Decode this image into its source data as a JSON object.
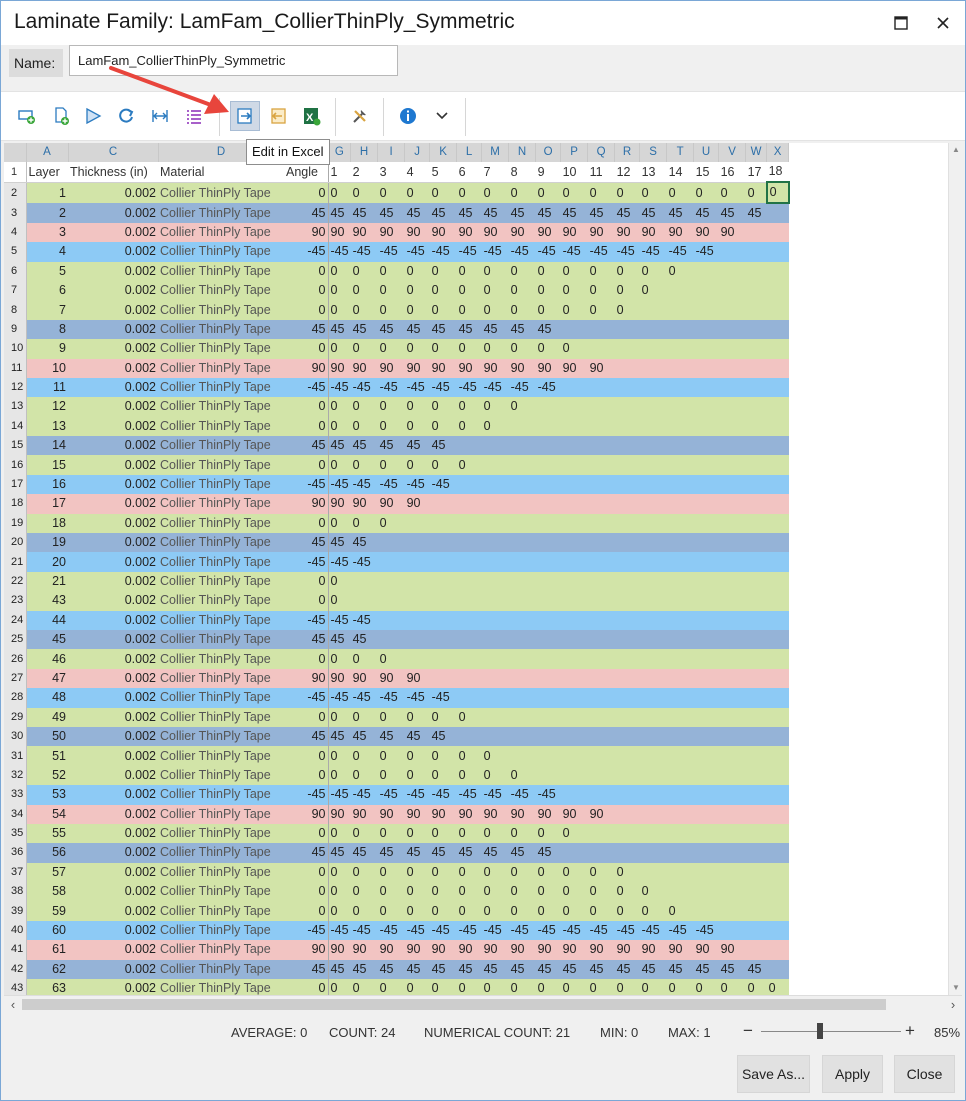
{
  "window": {
    "title": "Laminate Family: LamFam_CollierThinPly_Symmetric",
    "maximize_label": "□",
    "close_label": "✕"
  },
  "name_field": {
    "label": "Name:",
    "value": "LamFam_CollierThinPly_Symmetric"
  },
  "toolbar": {
    "items": [
      {
        "icon": "add-row-icon"
      },
      {
        "icon": "add-file-icon"
      },
      {
        "icon": "play-icon"
      },
      {
        "icon": "refresh-icon"
      },
      {
        "icon": "column-width-icon"
      },
      {
        "icon": "list-icon"
      },
      {
        "icon": "edit-in-excel-icon"
      },
      {
        "icon": "import-icon"
      },
      {
        "icon": "excel-icon"
      },
      {
        "icon": "tools-icon"
      },
      {
        "icon": "info-icon"
      },
      {
        "icon": "chevron-down-icon"
      }
    ],
    "tooltip": "Edit in Excel"
  },
  "grid": {
    "column_letters": [
      "A",
      "C",
      "D",
      "",
      "G",
      "H",
      "I",
      "J",
      "K",
      "L",
      "M",
      "N",
      "O",
      "P",
      "Q",
      "R",
      "S",
      "T",
      "U",
      "V",
      "W",
      "X"
    ],
    "headers": [
      "Layer",
      "Thickness (in)",
      "Material",
      "Angle",
      "1",
      "2",
      "3",
      "4",
      "5",
      "6",
      "7",
      "8",
      "9",
      "10",
      "11",
      "12",
      "13",
      "14",
      "15",
      "16",
      "17",
      "18"
    ],
    "rows": [
      {
        "rn": "2",
        "layer": "1",
        "thk": "0.002",
        "mat": "Collier ThinPly Tape",
        "angle": "0",
        "color": "g",
        "cells": 18
      },
      {
        "rn": "3",
        "layer": "2",
        "thk": "0.002",
        "mat": "Collier ThinPly Tape",
        "angle": "45",
        "color": "b",
        "cells": 17
      },
      {
        "rn": "4",
        "layer": "3",
        "thk": "0.002",
        "mat": "Collier ThinPly Tape",
        "angle": "90",
        "color": "p",
        "cells": 16
      },
      {
        "rn": "5",
        "layer": "4",
        "thk": "0.002",
        "mat": "Collier ThinPly Tape",
        "angle": "-45",
        "color": "l",
        "cells": 15
      },
      {
        "rn": "6",
        "layer": "5",
        "thk": "0.002",
        "mat": "Collier ThinPly Tape",
        "angle": "0",
        "color": "g",
        "cells": 14
      },
      {
        "rn": "7",
        "layer": "6",
        "thk": "0.002",
        "mat": "Collier ThinPly Tape",
        "angle": "0",
        "color": "g",
        "cells": 13
      },
      {
        "rn": "8",
        "layer": "7",
        "thk": "0.002",
        "mat": "Collier ThinPly Tape",
        "angle": "0",
        "color": "g",
        "cells": 12
      },
      {
        "rn": "9",
        "layer": "8",
        "thk": "0.002",
        "mat": "Collier ThinPly Tape",
        "angle": "45",
        "color": "b",
        "cells": 9
      },
      {
        "rn": "10",
        "layer": "9",
        "thk": "0.002",
        "mat": "Collier ThinPly Tape",
        "angle": "0",
        "color": "g",
        "cells": 10
      },
      {
        "rn": "11",
        "layer": "10",
        "thk": "0.002",
        "mat": "Collier ThinPly Tape",
        "angle": "90",
        "color": "p",
        "cells": 11
      },
      {
        "rn": "12",
        "layer": "11",
        "thk": "0.002",
        "mat": "Collier ThinPly Tape",
        "angle": "-45",
        "color": "l",
        "cells": 9
      },
      {
        "rn": "13",
        "layer": "12",
        "thk": "0.002",
        "mat": "Collier ThinPly Tape",
        "angle": "0",
        "color": "g",
        "cells": 8
      },
      {
        "rn": "14",
        "layer": "13",
        "thk": "0.002",
        "mat": "Collier ThinPly Tape",
        "angle": "0",
        "color": "g",
        "cells": 7
      },
      {
        "rn": "15",
        "layer": "14",
        "thk": "0.002",
        "mat": "Collier ThinPly Tape",
        "angle": "45",
        "color": "b",
        "cells": 5
      },
      {
        "rn": "16",
        "layer": "15",
        "thk": "0.002",
        "mat": "Collier ThinPly Tape",
        "angle": "0",
        "color": "g",
        "cells": 6
      },
      {
        "rn": "17",
        "layer": "16",
        "thk": "0.002",
        "mat": "Collier ThinPly Tape",
        "angle": "-45",
        "color": "l",
        "cells": 5
      },
      {
        "rn": "18",
        "layer": "17",
        "thk": "0.002",
        "mat": "Collier ThinPly Tape",
        "angle": "90",
        "color": "p",
        "cells": 4
      },
      {
        "rn": "19",
        "layer": "18",
        "thk": "0.002",
        "mat": "Collier ThinPly Tape",
        "angle": "0",
        "color": "g",
        "cells": 3
      },
      {
        "rn": "20",
        "layer": "19",
        "thk": "0.002",
        "mat": "Collier ThinPly Tape",
        "angle": "45",
        "color": "b",
        "cells": 2
      },
      {
        "rn": "21",
        "layer": "20",
        "thk": "0.002",
        "mat": "Collier ThinPly Tape",
        "angle": "-45",
        "color": "l",
        "cells": 2
      },
      {
        "rn": "22",
        "layer": "21",
        "thk": "0.002",
        "mat": "Collier ThinPly Tape",
        "angle": "0",
        "color": "g",
        "cells": 1
      },
      {
        "rn": "23",
        "layer": "43",
        "thk": "0.002",
        "mat": "Collier ThinPly Tape",
        "angle": "0",
        "color": "g",
        "cells": 1
      },
      {
        "rn": "24",
        "layer": "44",
        "thk": "0.002",
        "mat": "Collier ThinPly Tape",
        "angle": "-45",
        "color": "l",
        "cells": 2
      },
      {
        "rn": "25",
        "layer": "45",
        "thk": "0.002",
        "mat": "Collier ThinPly Tape",
        "angle": "45",
        "color": "b",
        "cells": 2
      },
      {
        "rn": "26",
        "layer": "46",
        "thk": "0.002",
        "mat": "Collier ThinPly Tape",
        "angle": "0",
        "color": "g",
        "cells": 3
      },
      {
        "rn": "27",
        "layer": "47",
        "thk": "0.002",
        "mat": "Collier ThinPly Tape",
        "angle": "90",
        "color": "p",
        "cells": 4
      },
      {
        "rn": "28",
        "layer": "48",
        "thk": "0.002",
        "mat": "Collier ThinPly Tape",
        "angle": "-45",
        "color": "l",
        "cells": 5
      },
      {
        "rn": "29",
        "layer": "49",
        "thk": "0.002",
        "mat": "Collier ThinPly Tape",
        "angle": "0",
        "color": "g",
        "cells": 6
      },
      {
        "rn": "30",
        "layer": "50",
        "thk": "0.002",
        "mat": "Collier ThinPly Tape",
        "angle": "45",
        "color": "b",
        "cells": 5
      },
      {
        "rn": "31",
        "layer": "51",
        "thk": "0.002",
        "mat": "Collier ThinPly Tape",
        "angle": "0",
        "color": "g",
        "cells": 7
      },
      {
        "rn": "32",
        "layer": "52",
        "thk": "0.002",
        "mat": "Collier ThinPly Tape",
        "angle": "0",
        "color": "g",
        "cells": 8
      },
      {
        "rn": "33",
        "layer": "53",
        "thk": "0.002",
        "mat": "Collier ThinPly Tape",
        "angle": "-45",
        "color": "l",
        "cells": 9
      },
      {
        "rn": "34",
        "layer": "54",
        "thk": "0.002",
        "mat": "Collier ThinPly Tape",
        "angle": "90",
        "color": "p",
        "cells": 11
      },
      {
        "rn": "35",
        "layer": "55",
        "thk": "0.002",
        "mat": "Collier ThinPly Tape",
        "angle": "0",
        "color": "g",
        "cells": 10
      },
      {
        "rn": "36",
        "layer": "56",
        "thk": "0.002",
        "mat": "Collier ThinPly Tape",
        "angle": "45",
        "color": "b",
        "cells": 9
      },
      {
        "rn": "37",
        "layer": "57",
        "thk": "0.002",
        "mat": "Collier ThinPly Tape",
        "angle": "0",
        "color": "g",
        "cells": 12
      },
      {
        "rn": "38",
        "layer": "58",
        "thk": "0.002",
        "mat": "Collier ThinPly Tape",
        "angle": "0",
        "color": "g",
        "cells": 13
      },
      {
        "rn": "39",
        "layer": "59",
        "thk": "0.002",
        "mat": "Collier ThinPly Tape",
        "angle": "0",
        "color": "g",
        "cells": 14
      },
      {
        "rn": "40",
        "layer": "60",
        "thk": "0.002",
        "mat": "Collier ThinPly Tape",
        "angle": "-45",
        "color": "l",
        "cells": 15
      },
      {
        "rn": "41",
        "layer": "61",
        "thk": "0.002",
        "mat": "Collier ThinPly Tape",
        "angle": "90",
        "color": "p",
        "cells": 16
      },
      {
        "rn": "42",
        "layer": "62",
        "thk": "0.002",
        "mat": "Collier ThinPly Tape",
        "angle": "45",
        "color": "b",
        "cells": 17
      },
      {
        "rn": "43",
        "layer": "63",
        "thk": "0.002",
        "mat": "Collier ThinPly Tape",
        "angle": "0",
        "color": "g",
        "cells": 18
      }
    ]
  },
  "status": {
    "average": "AVERAGE: 0",
    "count": "COUNT: 24",
    "numerical_count": "NUMERICAL COUNT: 21",
    "min": "MIN: 0",
    "max": "MAX: 1",
    "zoom_minus": "−",
    "zoom_plus": "+",
    "zoom": "85%"
  },
  "buttons": {
    "save_as": "Save As...",
    "apply": "Apply",
    "close": "Close"
  },
  "colors": {
    "green_row": "#d2e4a8",
    "blue_row": "#95b3d7",
    "pink_row": "#f2c4c2",
    "lightblue_row": "#8dcaf5",
    "column_header_text": "#2d6fa8",
    "arrow": "#e8453c"
  }
}
